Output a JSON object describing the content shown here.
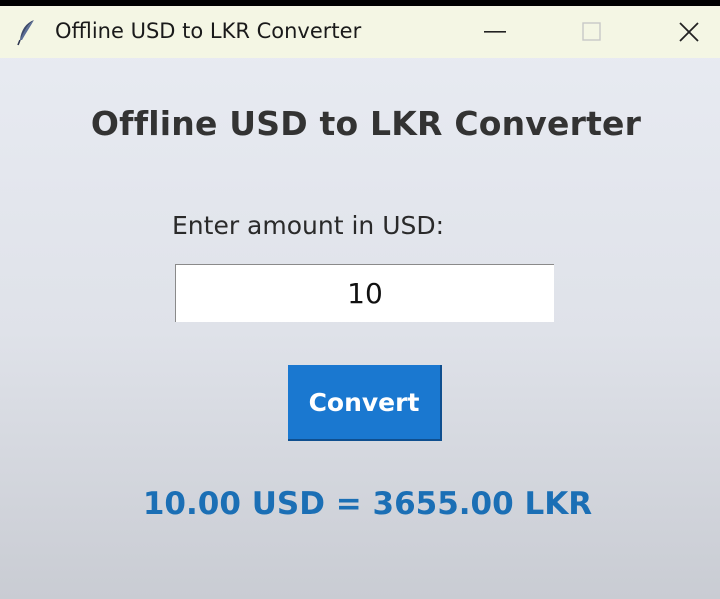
{
  "window": {
    "title": "Offline USD to LKR Converter"
  },
  "app": {
    "heading": "Offline USD to LKR Converter",
    "amount_label": "Enter amount in USD:",
    "amount_value": "10",
    "convert_label": "Convert",
    "result_text": "10.00 USD = 3655.00 LKR"
  },
  "icons": {
    "app": "feather-icon",
    "minimize": "minimize-icon",
    "maximize": "maximize-icon",
    "close": "close-icon"
  },
  "colors": {
    "titlebar_bg": "#f4f6e4",
    "window_bg": "#e4e7ee",
    "button_bg": "#1a78d0",
    "button_text": "#ffffff",
    "result_text": "#1b6fb5",
    "heading_text": "#333333"
  }
}
